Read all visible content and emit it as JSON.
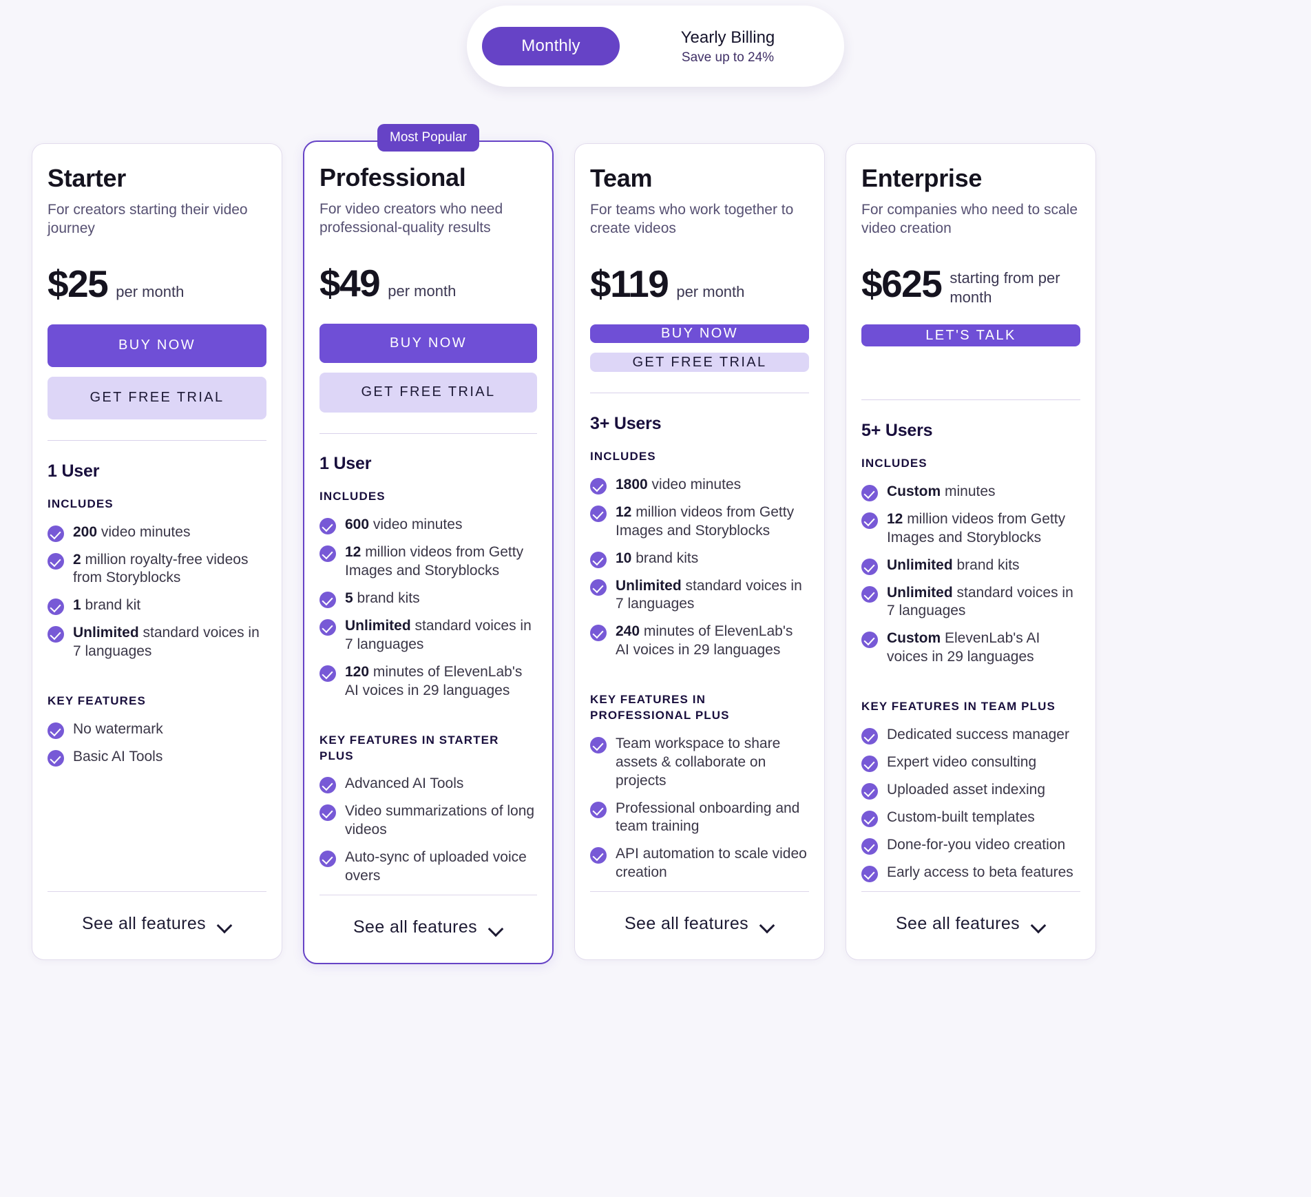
{
  "billing_toggle": {
    "monthly_label": "Monthly",
    "yearly_label": "Yearly Billing",
    "yearly_savings": "Save up to 24%",
    "active": "Monthly",
    "accent_color": "#6643c6"
  },
  "plans": [
    {
      "name": "Starter",
      "description": "For creators starting their video journey",
      "price": "$25",
      "price_unit": "per month",
      "primary_cta": "BUY NOW",
      "secondary_cta": "GET FREE TRIAL",
      "has_secondary_cta": true,
      "badge": null,
      "featured": false,
      "users": "1 User",
      "includes_label": "INCLUDES",
      "includes": [
        {
          "bold": "200",
          "rest": " video minutes"
        },
        {
          "bold": "2",
          "rest": " million royalty-free videos from Storyblocks"
        },
        {
          "bold": "1",
          "rest": " brand kit"
        },
        {
          "bold": "Unlimited",
          "rest": " standard voices in 7 languages"
        }
      ],
      "key_features_label": "KEY FEATURES",
      "key_features": [
        "No watermark",
        "Basic AI Tools"
      ],
      "see_all_label": "See all features"
    },
    {
      "name": "Professional",
      "description": "For video creators who need professional-quality results",
      "price": "$49",
      "price_unit": "per month",
      "primary_cta": "BUY NOW",
      "secondary_cta": "GET FREE TRIAL",
      "has_secondary_cta": true,
      "badge": "Most Popular",
      "featured": true,
      "users": "1 User",
      "includes_label": "INCLUDES",
      "includes": [
        {
          "bold": "600",
          "rest": " video minutes"
        },
        {
          "bold": "12",
          "rest": " million videos from Getty Images and Storyblocks"
        },
        {
          "bold": "5",
          "rest": " brand kits"
        },
        {
          "bold": "Unlimited",
          "rest": " standard voices in 7 languages"
        },
        {
          "bold": "120",
          "rest": " minutes of ElevenLab's AI voices in 29 languages"
        }
      ],
      "key_features_label": "KEY FEATURES IN STARTER PLUS",
      "key_features": [
        "Advanced AI Tools",
        "Video summarizations of long videos",
        "Auto-sync of uploaded voice overs"
      ],
      "see_all_label": "See all features"
    },
    {
      "name": "Team",
      "description": "For teams who work together to create videos",
      "price": "$119",
      "price_unit": "per month",
      "primary_cta": "BUY NOW",
      "secondary_cta": "GET FREE TRIAL",
      "has_secondary_cta": true,
      "badge": null,
      "featured": false,
      "users": "3+ Users",
      "includes_label": "INCLUDES",
      "includes": [
        {
          "bold": "1800",
          "rest": " video minutes"
        },
        {
          "bold": "12",
          "rest": " million videos from Getty Images and Storyblocks"
        },
        {
          "bold": "10",
          "rest": " brand kits"
        },
        {
          "bold": "Unlimited",
          "rest": " standard voices in 7 languages"
        },
        {
          "bold": "240",
          "rest": " minutes of ElevenLab's AI voices in 29 languages"
        }
      ],
      "key_features_label": "KEY FEATURES IN PROFESSIONAL PLUS",
      "key_features": [
        "Team workspace to share assets & collaborate on projects",
        "Professional onboarding and team training",
        "API automation to scale video creation"
      ],
      "see_all_label": "See all features"
    },
    {
      "name": "Enterprise",
      "description": "For companies who need  to scale video creation",
      "price": "$625",
      "price_unit": "starting from per month",
      "primary_cta": "LET'S TALK",
      "secondary_cta": null,
      "has_secondary_cta": false,
      "badge": null,
      "featured": false,
      "users": "5+ Users",
      "includes_label": "INCLUDES",
      "includes": [
        {
          "bold": "Custom",
          "rest": " minutes"
        },
        {
          "bold": "12",
          "rest": " million videos from Getty Images and Storyblocks"
        },
        {
          "bold": "Unlimited",
          "rest": " brand kits"
        },
        {
          "bold": "Unlimited",
          "rest": " standard voices in 7 languages"
        },
        {
          "bold": "Custom",
          "rest": " ElevenLab's AI voices in 29 languages"
        }
      ],
      "key_features_label": "KEY FEATURES IN TEAM PLUS",
      "key_features": [
        "Dedicated success manager",
        "Expert video consulting",
        "Uploaded asset indexing",
        "Custom-built templates",
        "Done-for-you video creation",
        "Early access to beta features"
      ],
      "see_all_label": "See all features"
    }
  ]
}
